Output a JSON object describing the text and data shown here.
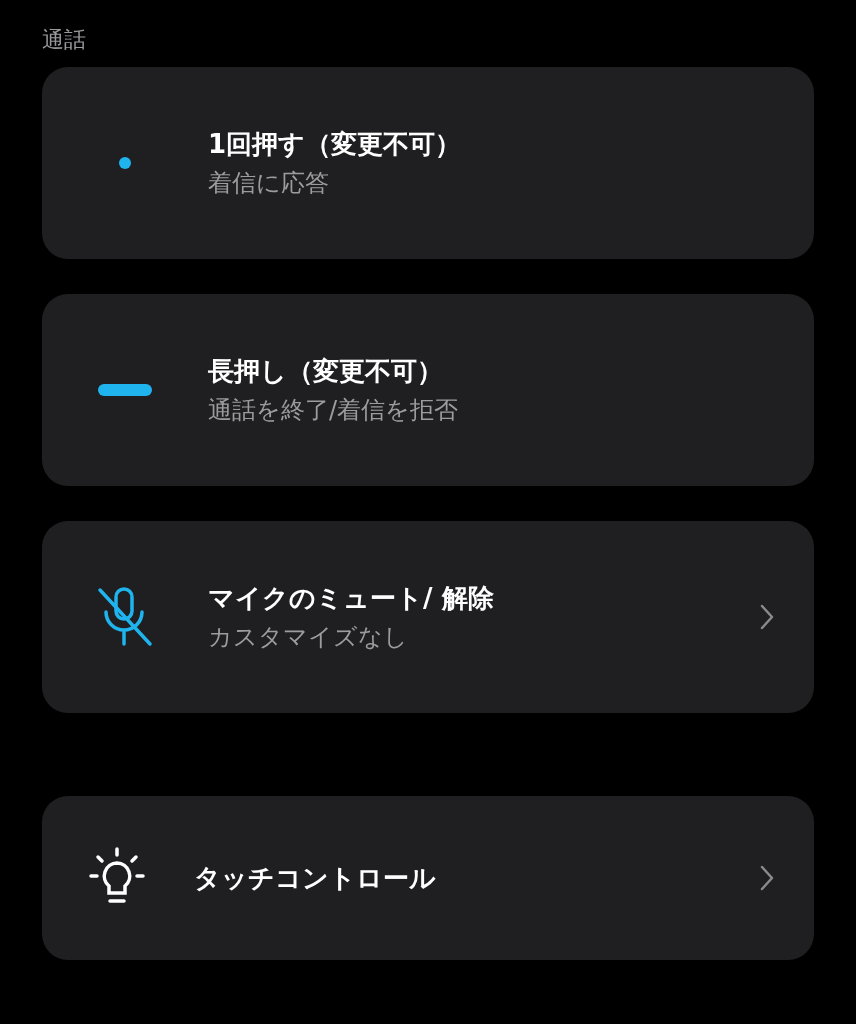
{
  "sections": [
    {
      "title": "通話",
      "items": [
        {
          "kind": "press",
          "title": "1回押す（変更不可）",
          "subtitle": "着信に応答",
          "navigable": false
        },
        {
          "kind": "hold",
          "title": "長押し（変更不可）",
          "subtitle": "通話を終了/着信を拒否",
          "navigable": false
        },
        {
          "kind": "mute",
          "title": "マイクのミュート/ 解除",
          "subtitle": "カスタマイズなし",
          "navigable": true
        }
      ]
    },
    {
      "items": [
        {
          "kind": "touch",
          "title": "タッチコントロール",
          "navigable": true
        }
      ]
    }
  ]
}
